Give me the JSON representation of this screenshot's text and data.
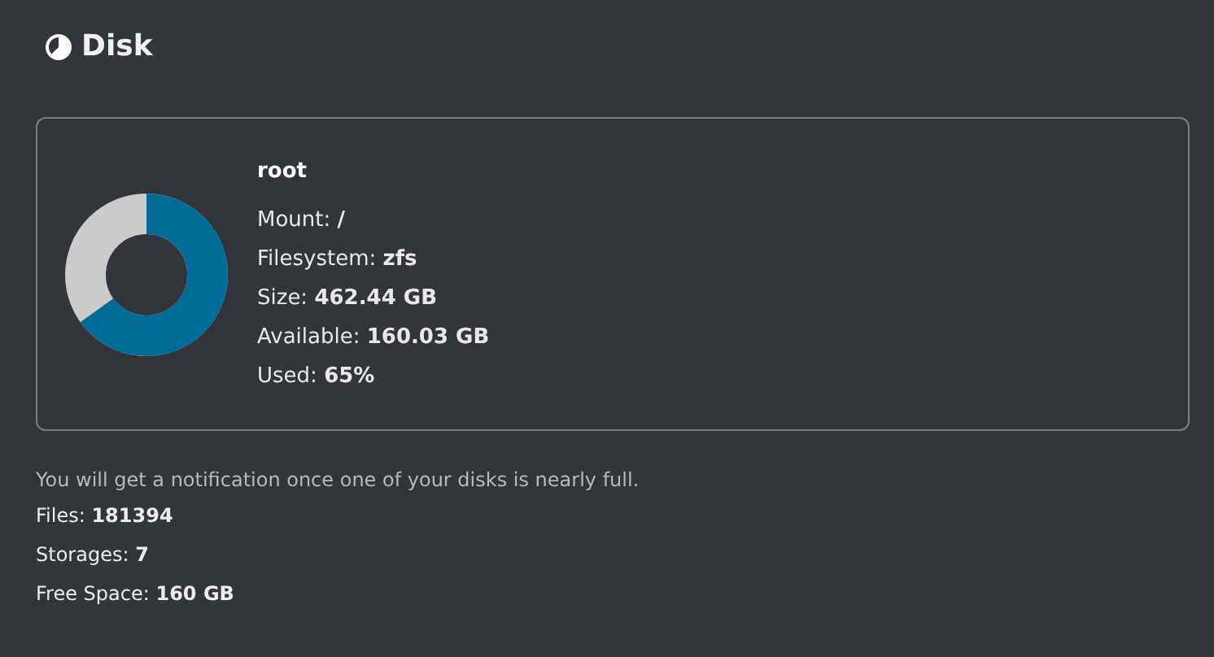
{
  "title": "Disk",
  "disk": {
    "name": "root",
    "level": 0.65,
    "details": [
      "Mount: **/**",
      "Filesystem: **zfs**",
      "Size: **462.44 GB**",
      "Available: **160.03 GB**",
      "Used: **65%**"
    ]
  },
  "note": "You will get a notification once one of your disks is nearly full.",
  "stats": [
    "Files: **181394**",
    "Storages: **7**",
    "Free Space: **160 GB**"
  ]
}
